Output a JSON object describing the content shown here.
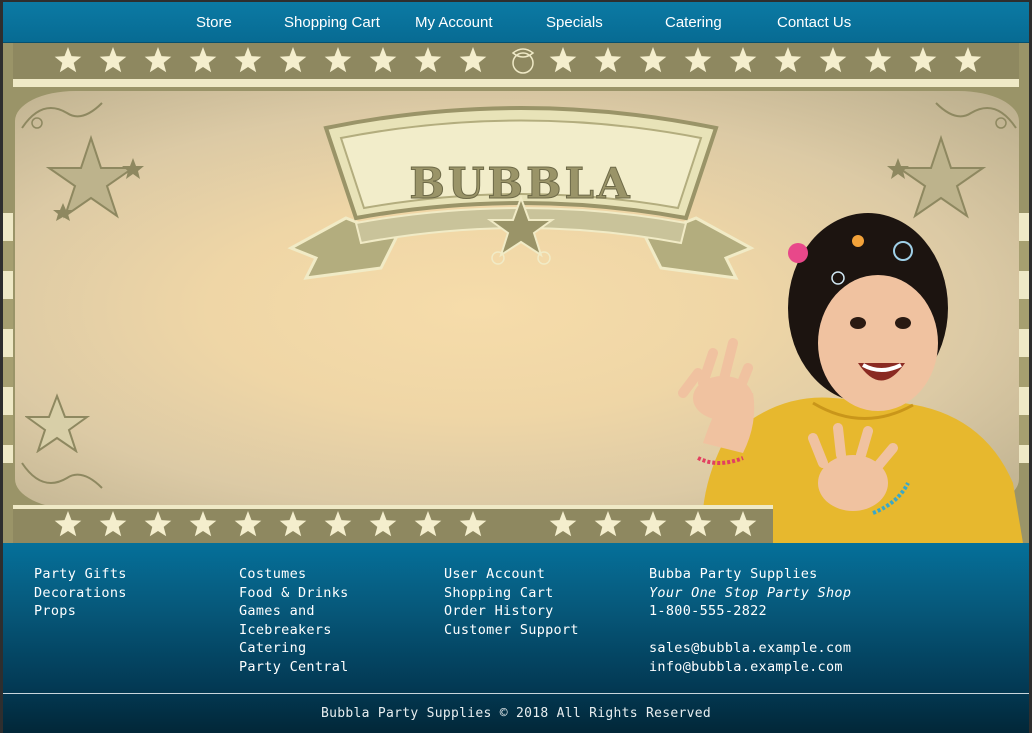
{
  "topnav": {
    "items": [
      "Store",
      "Shopping Cart",
      "My Account",
      "Specials",
      "Catering",
      "Contact Us"
    ]
  },
  "banner": {
    "logo_text": "BUBBLA",
    "photo": "laughing-girl-in-yellow-dress-photo",
    "colors": {
      "olive": "#9a9468",
      "cream": "#efe9c6",
      "star": "#f4eecd"
    }
  },
  "footer": {
    "col1": [
      "Party Gifts",
      "Decorations",
      "Props"
    ],
    "col2": [
      "Costumes",
      "Food & Drinks",
      "Games and",
      "Icebreakers",
      "Catering",
      "Party Central"
    ],
    "col3": [
      "User Account",
      "Shopping Cart",
      "Order History",
      "Customer Support"
    ],
    "contact": {
      "company": "Bubba Party Supplies",
      "tagline": "Your One Stop Party Shop",
      "phone": "1-800-555-2822",
      "email_sales": "sales@bubbla.example.com",
      "email_info": "info@bubbla.example.com"
    },
    "copyright": "Bubbla Party Supplies © 2018 All Rights Reserved"
  }
}
